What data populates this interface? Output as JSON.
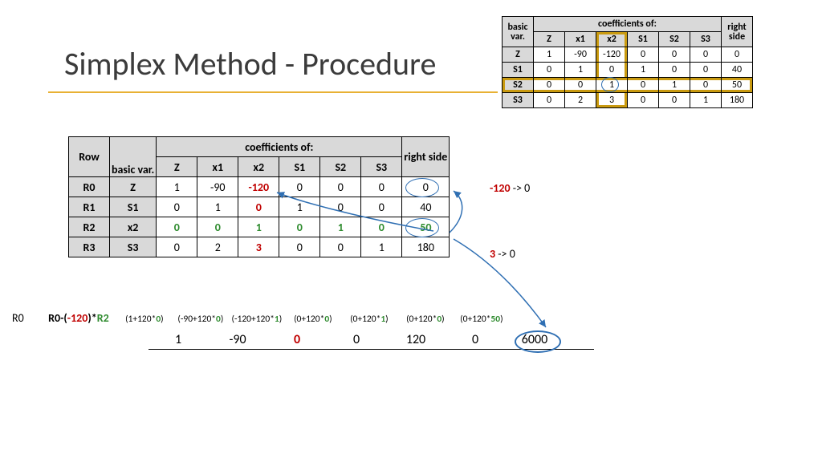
{
  "title": "Simplex Method - Procedure",
  "small_tableau": {
    "header_group": "coefficients of:",
    "corner1": "basic",
    "corner2": "var.",
    "cols": [
      "Z",
      "x1",
      "x2",
      "S1",
      "S2",
      "S3"
    ],
    "rhs_label": "right side",
    "rows": [
      {
        "name": "Z",
        "vals": [
          "1",
          "-90",
          "-120",
          "0",
          "0",
          "0"
        ],
        "rhs": "0"
      },
      {
        "name": "S1",
        "vals": [
          "0",
          "1",
          "0",
          "1",
          "0",
          "0"
        ],
        "rhs": "40"
      },
      {
        "name": "S2",
        "vals": [
          "0",
          "0",
          "1",
          "0",
          "1",
          "0"
        ],
        "rhs": "50"
      },
      {
        "name": "S3",
        "vals": [
          "0",
          "2",
          "3",
          "0",
          "0",
          "1"
        ],
        "rhs": "180"
      }
    ],
    "pivot_col_index": 2,
    "pivot_row_index": 2
  },
  "main_tableau": {
    "row_label": "Row",
    "basic_label": "basic var.",
    "header_group": "coefficients of:",
    "cols": [
      "Z",
      "x1",
      "x2",
      "S1",
      "S2",
      "S3"
    ],
    "rhs_label": "right side",
    "rows": [
      {
        "id": "R0",
        "basic": "Z",
        "vals": [
          "1",
          "-90",
          "-120",
          "0",
          "0",
          "0"
        ],
        "rhs": "0",
        "styles": [
          "",
          "",
          "red",
          "",
          "",
          ""
        ],
        "rhs_circ": true
      },
      {
        "id": "R1",
        "basic": "S1",
        "vals": [
          "0",
          "1",
          "0",
          "1",
          "0",
          "0"
        ],
        "rhs": "40",
        "styles": [
          "",
          "",
          "red",
          "",
          "",
          ""
        ]
      },
      {
        "id": "R2",
        "basic": "x2",
        "vals": [
          "0",
          "0",
          "1",
          "0",
          "1",
          "0"
        ],
        "rhs": "50",
        "styles": [
          "green",
          "green",
          "green",
          "green",
          "green",
          "green"
        ],
        "rhs_style": "green",
        "rhs_circ": true
      },
      {
        "id": "R3",
        "basic": "S3",
        "vals": [
          "0",
          "2",
          "3",
          "0",
          "0",
          "1"
        ],
        "rhs": "180",
        "styles": [
          "",
          "",
          "red",
          "",
          "",
          ""
        ]
      }
    ]
  },
  "annotations": {
    "a1_prefix": "-120",
    "a1_suffix": " -> 0",
    "a2_prefix": "3",
    "a2_suffix": " -> 0"
  },
  "rowop": {
    "row_id": "R0",
    "formula_left": "R0-(",
    "formula_mid": "-120",
    "formula_right": ")*",
    "formula_r2": "R2",
    "terms": [
      {
        "a": "(1+120*",
        "b": "0",
        "c": ")"
      },
      {
        "a": "(-90+120*",
        "b": "0",
        "c": ")"
      },
      {
        "a": "(-120+120*",
        "b": "1",
        "c": ")"
      },
      {
        "a": "(0+120*",
        "b": "0",
        "c": ")"
      },
      {
        "a": "(0+120*",
        "b": "1",
        "c": ")"
      },
      {
        "a": "(0+120*",
        "b": "0",
        "c": ")"
      },
      {
        "a": "(0+120*",
        "b": "50",
        "c": ")"
      }
    ],
    "result": [
      "1",
      "-90",
      "0",
      "0",
      "120",
      "0",
      "6000"
    ],
    "result_red_index": 2,
    "result_circ_index": 6
  }
}
